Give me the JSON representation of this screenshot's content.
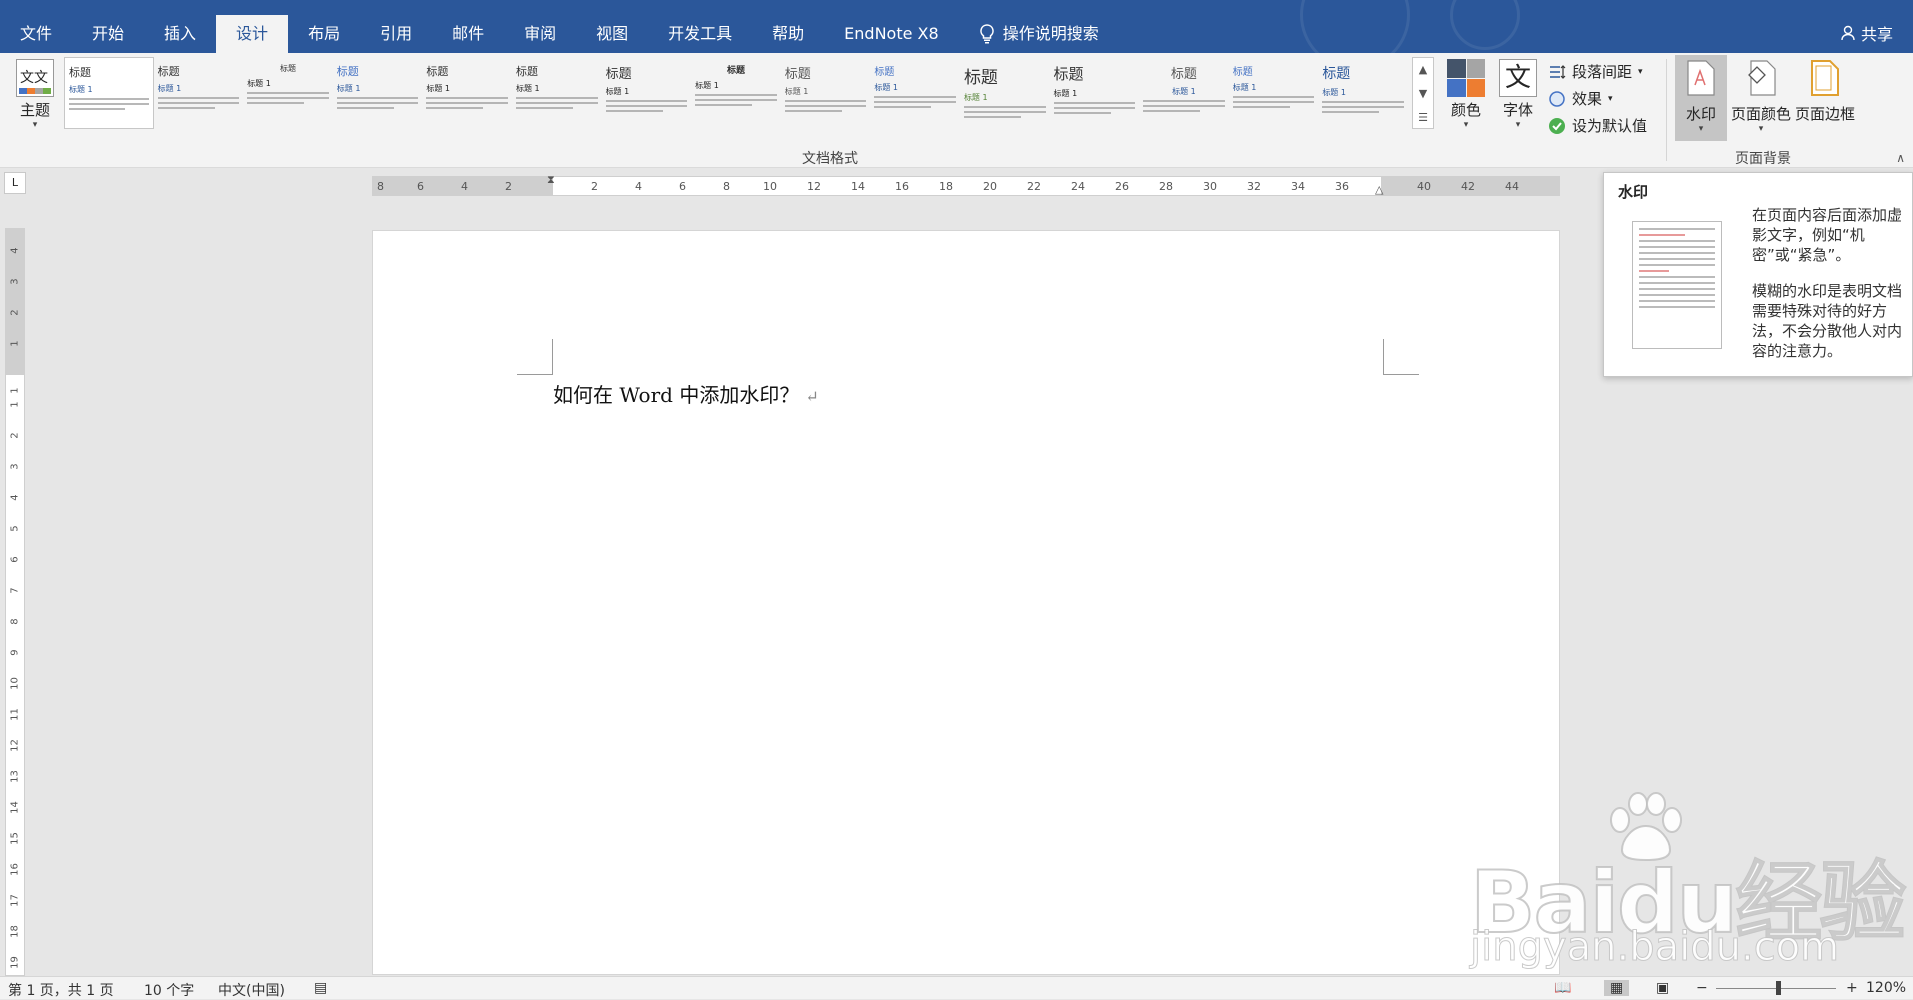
{
  "tabs": [
    "文件",
    "开始",
    "插入",
    "设计",
    "布局",
    "引用",
    "邮件",
    "审阅",
    "视图",
    "开发工具",
    "帮助",
    "EndNote X8"
  ],
  "active_tab": "设计",
  "search_label": "操作说明搜索",
  "share_label": "共享",
  "ribbon": {
    "theme_label": "主题",
    "theme_icon_text": "文文",
    "gallery_heading": "标题",
    "gallery_subheading": "标题 1",
    "group_doc_format": "文档格式",
    "colors_label": "颜色",
    "fonts_label": "字体",
    "fonts_icon_text": "文",
    "paragraph_spacing": "段落间距",
    "effects": "效果",
    "set_default": "设为默认值",
    "watermark": "水印",
    "page_color": "页面颜色",
    "page_border": "页面边框",
    "group_page_background": "页面背景"
  },
  "ruler": {
    "left_ticks": [
      "8",
      "6",
      "4",
      "2"
    ],
    "right_ticks": [
      "2",
      "4",
      "6",
      "8",
      "10",
      "12",
      "14",
      "16",
      "18",
      "20",
      "22",
      "24",
      "26",
      "28",
      "30",
      "32",
      "34",
      "36",
      "40",
      "42",
      "44"
    ],
    "v_ticks": [
      "4",
      "3",
      "2",
      "1",
      "1",
      "1",
      "2",
      "3",
      "4",
      "5",
      "6",
      "7",
      "8",
      "9",
      "10",
      "11",
      "12",
      "13",
      "14",
      "15",
      "16",
      "17",
      "18",
      "19"
    ]
  },
  "document": {
    "text": "如何在 Word 中添加水印？",
    "para_mark": "↵"
  },
  "tooltip": {
    "title": "水印",
    "desc1": "在页面内容后面添加虚影文字，例如“机密”或“紧急”。",
    "desc2": "模糊的水印是表明文档需要特殊对待的好方法，不会分散他人对内容的注意力。"
  },
  "watermark": {
    "brand": "Baidu经验",
    "url": "jingyan.baidu.com"
  },
  "status": {
    "page": "第 1 页，共 1 页",
    "words": "10 个字",
    "language": "中文(中国)",
    "zoom": "120%"
  },
  "colors": {
    "title_bar": "#2b579a",
    "ribbon": "#f3f3f3",
    "workspace": "#e6e6e6"
  }
}
